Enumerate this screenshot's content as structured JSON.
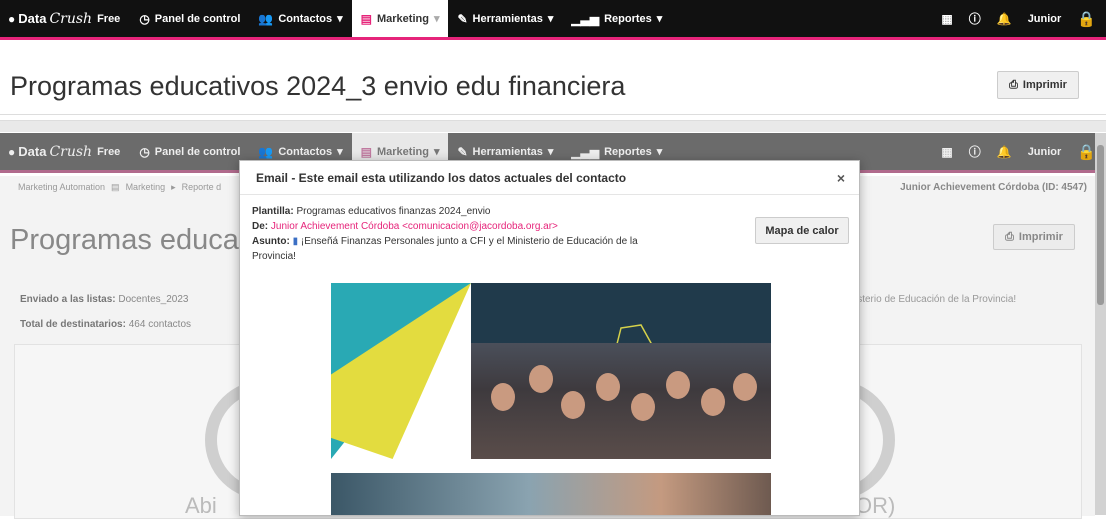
{
  "nav": {
    "logo_data": "Data",
    "logo_crush": "Crush",
    "logo_free": "Free",
    "items": [
      {
        "label": "Panel de control"
      },
      {
        "label": "Contactos"
      },
      {
        "label": "Marketing"
      },
      {
        "label": "Herramientas"
      },
      {
        "label": "Reportes"
      }
    ],
    "user": "Junior"
  },
  "page": {
    "title": "Programas educativos 2024_3 envio edu financiera",
    "print_label": "Imprimir"
  },
  "background": {
    "breadcrumb": [
      "Marketing Automation",
      "Marketing",
      "Reporte d"
    ],
    "account": "Junior Achievement Córdoba (ID: 4547)",
    "title": "Programas educat",
    "print_label": "Imprimir",
    "lists_label": "Enviado a las listas:",
    "lists_value": "Docentes_2023",
    "total_label": "Total de destinatarios:",
    "total_value": "464 contactos",
    "subject_tail": "isterio de Educación de la Provincia!",
    "bottom_left": "Abi",
    "bottom_right": "OR)"
  },
  "modal": {
    "title": "Email - Este email esta utilizando los datos actuales del contacto",
    "close": "×",
    "template_label": "Plantilla:",
    "template_value": "Programas educativos finanzas 2024_envio",
    "from_label": "De:",
    "from_value": "Junior Achievement Córdoba <comunicacion@jacordoba.org.ar>",
    "subject_label": "Asunto:",
    "subject_value": "¡Enseñá Finanzas Personales junto a CFI y el Ministerio de Educación de la Provincia!",
    "heatmap_label": "Mapa de calor"
  },
  "colors": {
    "accent": "#e6247a",
    "nav_bg": "#111111"
  }
}
